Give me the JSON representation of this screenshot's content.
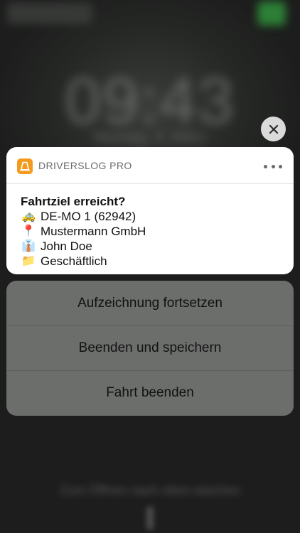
{
  "background": {
    "clock": "09:43",
    "date": "Montag, 4. März",
    "bottom_hint": "Zum Öffnen nach oben wischen"
  },
  "close_button": {
    "icon": "close-icon"
  },
  "notification": {
    "app_name": "DRIVERSLOG PRO",
    "app_icon": "traffic-cone-icon",
    "more_icon": "ellipsis-icon",
    "title": "Fahrtziel erreicht?",
    "lines": [
      {
        "emoji": "🚕",
        "icon": "taxi-icon",
        "text": "DE-MO 1 (62942)"
      },
      {
        "emoji": "📍",
        "icon": "pin-icon",
        "text": "Mustermann GmbH"
      },
      {
        "emoji": "👔",
        "icon": "person-icon",
        "text": "John Doe"
      },
      {
        "emoji": "📁",
        "icon": "folder-icon",
        "text": "Geschäftlich"
      }
    ]
  },
  "actions": [
    {
      "label": "Aufzeichnung fortsetzen"
    },
    {
      "label": "Beenden und speichern"
    },
    {
      "label": "Fahrt beenden"
    }
  ],
  "colors": {
    "app_icon": "#f39a1e",
    "card": "#ffffff",
    "action_sheet": "#737573"
  }
}
